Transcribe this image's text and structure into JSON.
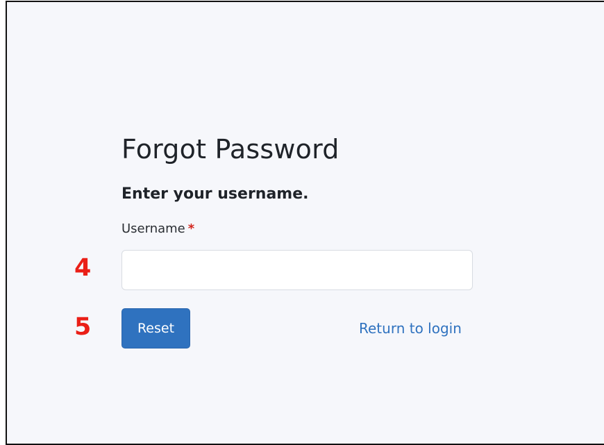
{
  "page": {
    "title": "Forgot Password",
    "subtitle": "Enter your username."
  },
  "form": {
    "username": {
      "label": "Username",
      "required_marker": "*",
      "value": "",
      "placeholder": ""
    },
    "reset_label": "Reset",
    "return_link_label": "Return to login"
  },
  "annotations": {
    "step_4": "4",
    "step_5": "5"
  },
  "colors": {
    "page_background": "#f6f7fb",
    "primary": "#2f72bf",
    "required": "#d3251d",
    "annotation": "#ea1f17",
    "text": "#1f2329"
  }
}
